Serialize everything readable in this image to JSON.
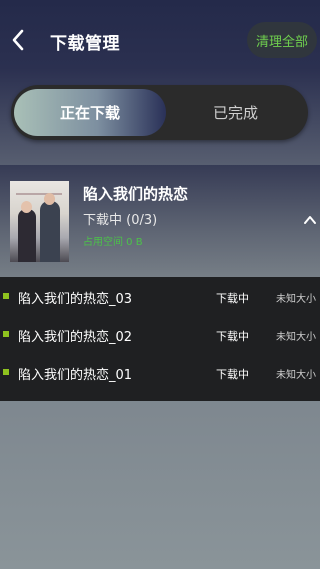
{
  "header": {
    "title": "下载管理",
    "clear_all": "清理全部"
  },
  "tabs": [
    {
      "label": "正在下载",
      "active": true
    },
    {
      "label": "已完成",
      "active": false
    }
  ],
  "group": {
    "title": "陷入我们的热恋",
    "status": "下载中 (0/3)",
    "space": "占用空间 0 B",
    "expanded": true
  },
  "items": [
    {
      "name": "陷入我们的热恋_03",
      "status": "下载中",
      "size": "未知大小"
    },
    {
      "name": "陷入我们的热恋_02",
      "status": "下载中",
      "size": "未知大小"
    },
    {
      "name": "陷入我们的热恋_01",
      "status": "下载中",
      "size": "未知大小"
    }
  ],
  "colors": {
    "accent_green": "#6fcf4e",
    "bullet_green": "#8ec21f"
  }
}
